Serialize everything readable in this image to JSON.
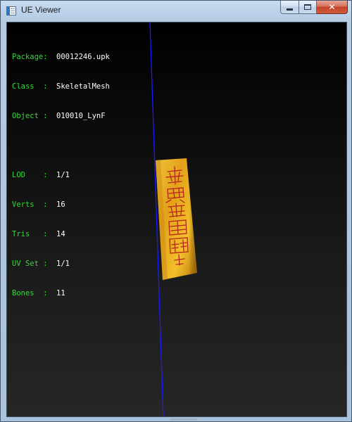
{
  "window": {
    "title": "UE Viewer",
    "icon": "app-window-icon",
    "buttons": {
      "minimize": "minimize-icon",
      "maximize": "maximize-icon",
      "close": "close-icon"
    }
  },
  "info": {
    "package_key": "Package:",
    "package_value": "00012246.upk",
    "class_key": "Class  :",
    "class_value": "SkeletalMesh",
    "object_key": "Object :",
    "object_value": "010010_LynF",
    "lod_key": "LOD    :",
    "lod_value": "1/1",
    "verts_key": "Verts  :",
    "verts_value": "16",
    "tris_key": "Tris   :",
    "tris_value": "14",
    "uvset_key": "UV Set :",
    "uvset_value": "1/1",
    "bones_key": "Bones  :",
    "bones_value": "11"
  },
  "colors": {
    "label_green": "#36d83a",
    "value_white": "#ffffff",
    "axis_blue": "#1a1aff",
    "talisman_gold": "#e0a21c",
    "talisman_ink": "#b3261a"
  }
}
